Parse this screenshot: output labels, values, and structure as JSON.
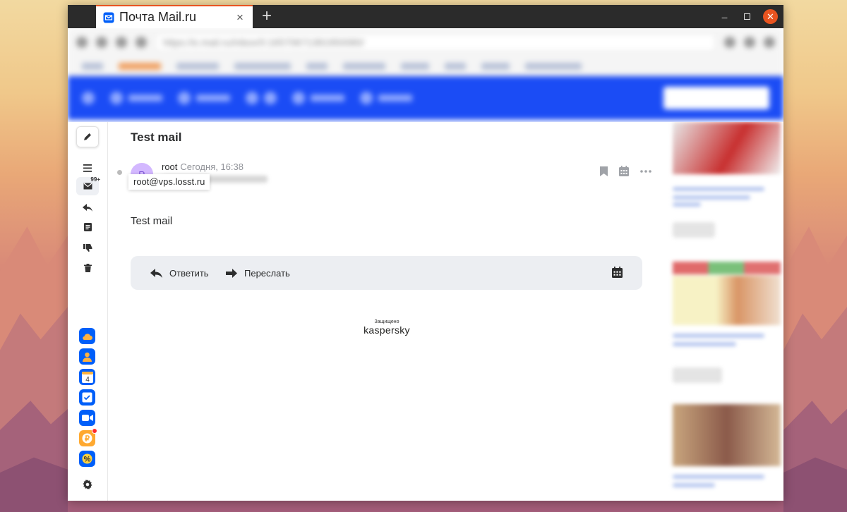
{
  "window": {
    "tab_title": "Почта Mail.ru",
    "tab_close": "×",
    "new_tab": "+",
    "minimize": "–",
    "close": "✕"
  },
  "browser": {
    "url": "https://e.mail.ru/inbox/0:16570671381950080/"
  },
  "sidebar": {
    "compose_icon": "pencil-icon",
    "unread_badge": "99+",
    "items": [
      {
        "name": "menu-icon"
      },
      {
        "name": "inbox-icon"
      },
      {
        "name": "reply-icon"
      },
      {
        "name": "note-icon"
      },
      {
        "name": "spam-icon"
      },
      {
        "name": "trash-icon"
      }
    ],
    "apps": [
      {
        "name": "cloud-icon"
      },
      {
        "name": "contacts-icon"
      },
      {
        "name": "calendar-app-icon",
        "label": "4"
      },
      {
        "name": "tasks-icon"
      },
      {
        "name": "video-call-icon"
      },
      {
        "name": "games-icon"
      },
      {
        "name": "discount-icon"
      }
    ],
    "settings_icon": "gear-icon"
  },
  "message": {
    "subject": "Test mail",
    "avatar_letter": "R",
    "sender_name": "root",
    "date": "Сегодня, 16:38",
    "tooltip": "root@vps.losst.ru",
    "body": "Test mail"
  },
  "reply_bar": {
    "reply_label": "Ответить",
    "forward_label": "Переслать"
  },
  "protection": {
    "caption": "Защищено",
    "brand": "kaspersky"
  },
  "colors": {
    "accent": "#005ff9",
    "nav_bg": "#1b4cf5",
    "avatar_bg": "#d3b8ff",
    "tab_accent": "#e95420"
  }
}
